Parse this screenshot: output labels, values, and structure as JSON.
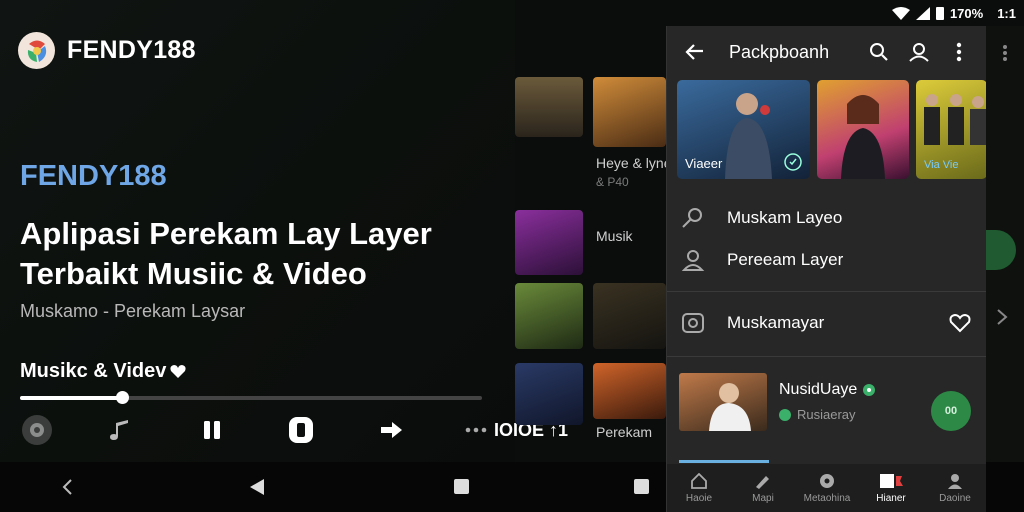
{
  "status_bar": {
    "battery": "170%",
    "time": "1:1"
  },
  "hero": {
    "brand": "FENDY188",
    "subtitle": "FENDY188",
    "title": "Aplipasi Perekam Lay Layer Terbaikt Musiic & Video",
    "caption": "Muskamo - Perekam Laysar",
    "music_label": "Musikc & Videv",
    "progress": 0.22,
    "controls_label": "IOIOE ↑1"
  },
  "grid": {
    "item1_title": "Heye & lyne",
    "item1_sub": "& P40",
    "item2_title": "Musik",
    "item2_sub": "Perekam"
  },
  "panel": {
    "title": "Packpboanh",
    "cards": [
      {
        "label": "Viaeer"
      },
      {
        "label": ""
      },
      {
        "label": "Via Vie"
      }
    ],
    "menu": [
      {
        "label": "Muskam Layeo",
        "icon": "pin-icon"
      },
      {
        "label": "Pereeam Layer",
        "icon": "user-icon"
      },
      {
        "label": "Muskamayar",
        "icon": "camera-icon"
      }
    ],
    "featured": {
      "name": "NusidUaye",
      "sub": "Rusiaeray",
      "fab_label": "00"
    },
    "bottom_nav": [
      {
        "label": "Haoie"
      },
      {
        "label": "Mapi"
      },
      {
        "label": "Metaohina"
      },
      {
        "label": "Hianer"
      },
      {
        "label": "Daoine"
      }
    ]
  },
  "colors": {
    "accent_blue": "#6ea6e6",
    "accent_green": "#2d8a46",
    "panel_bg": "#262726"
  }
}
